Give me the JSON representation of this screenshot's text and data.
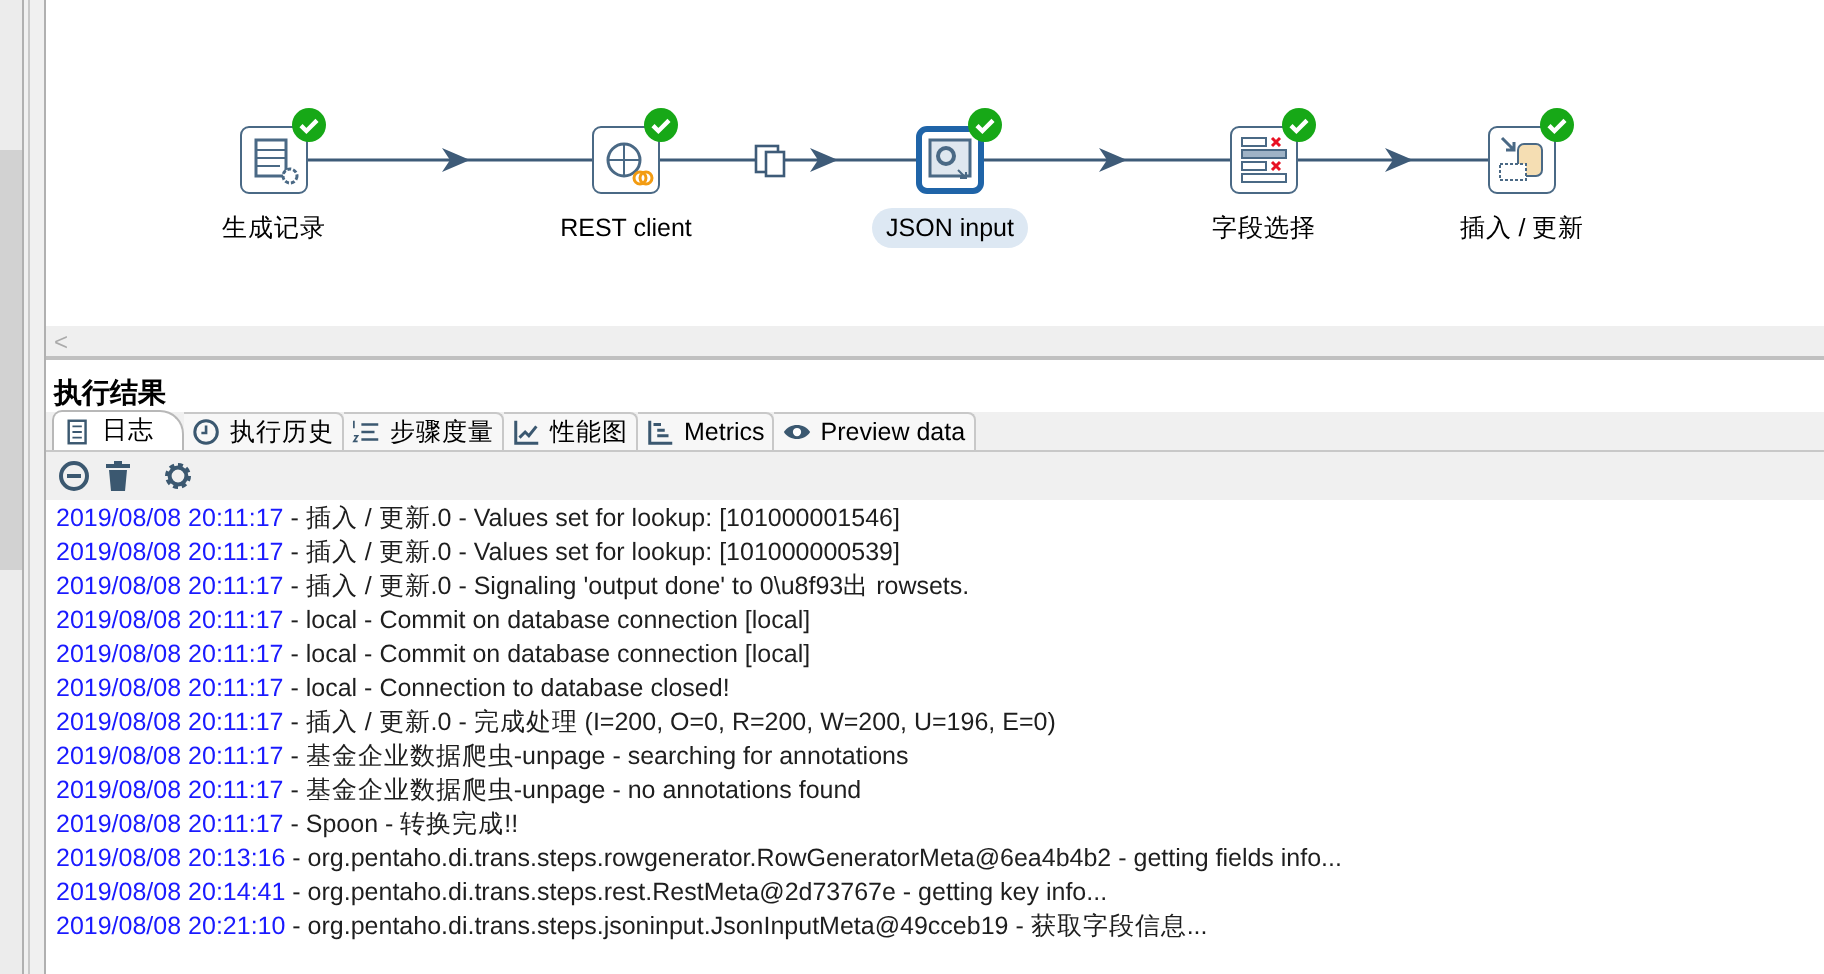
{
  "canvas": {
    "steps": [
      {
        "label": "生成记录",
        "kind": "generator",
        "selected": false,
        "ok": true
      },
      {
        "label": "REST client",
        "kind": "rest",
        "selected": false,
        "ok": true
      },
      {
        "label": "JSON input",
        "kind": "json",
        "selected": true,
        "ok": true
      },
      {
        "label": "字段选择",
        "kind": "select",
        "selected": false,
        "ok": true
      },
      {
        "label": "插入 / 更新",
        "kind": "insert",
        "selected": false,
        "ok": true
      }
    ],
    "hops": [
      {
        "copy": false
      },
      {
        "copy": true
      },
      {
        "copy": false
      },
      {
        "copy": false
      }
    ],
    "scroll_left": "<"
  },
  "results": {
    "title": "执行结果",
    "tabs": [
      {
        "label": "日志",
        "kind": "log",
        "selected": true
      },
      {
        "label": "执行历史",
        "kind": "history",
        "selected": false
      },
      {
        "label": "步骤度量",
        "kind": "steps",
        "selected": false
      },
      {
        "label": "性能图",
        "kind": "chart",
        "selected": false
      },
      {
        "label": "Metrics",
        "kind": "metrics",
        "selected": false
      },
      {
        "label": "Preview data",
        "kind": "eye",
        "selected": false
      }
    ],
    "log": [
      {
        "time": "2019/08/08 20:11:17",
        "text": " - 插入 / 更新.0 - Values set for lookup: [101000001546]"
      },
      {
        "time": "2019/08/08 20:11:17",
        "text": " - 插入 / 更新.0 - Values set for lookup: [101000000539]"
      },
      {
        "time": "2019/08/08 20:11:17",
        "text": " - 插入 / 更新.0 - Signaling 'output done' to 0\\u8f93出 rowsets."
      },
      {
        "time": "2019/08/08 20:11:17",
        "text": " - local - Commit on database connection [local]"
      },
      {
        "time": "2019/08/08 20:11:17",
        "text": " - local - Commit on database connection [local]"
      },
      {
        "time": "2019/08/08 20:11:17",
        "text": " - local - Connection to database closed!"
      },
      {
        "time": "2019/08/08 20:11:17",
        "text": " - 插入 / 更新.0 - 完成处理 (I=200, O=0, R=200, W=200, U=196, E=0)"
      },
      {
        "time": "2019/08/08 20:11:17",
        "text": " - 基金企业数据爬虫-unpage - searching for annotations"
      },
      {
        "time": "2019/08/08 20:11:17",
        "text": " - 基金企业数据爬虫-unpage - no annotations found"
      },
      {
        "time": "2019/08/08 20:11:17",
        "text": " - Spoon - 转换完成!!"
      },
      {
        "time": "2019/08/08 20:13:16",
        "text": " - org.pentaho.di.trans.steps.rowgenerator.RowGeneratorMeta@6ea4b4b2 - getting fields info..."
      },
      {
        "time": "2019/08/08 20:14:41",
        "text": " - org.pentaho.di.trans.steps.rest.RestMeta@2d73767e - getting key info..."
      },
      {
        "time": "2019/08/08 20:21:10",
        "text": " - org.pentaho.di.trans.steps.jsoninput.JsonInputMeta@49cceb19 - 获取字段信息..."
      }
    ]
  }
}
